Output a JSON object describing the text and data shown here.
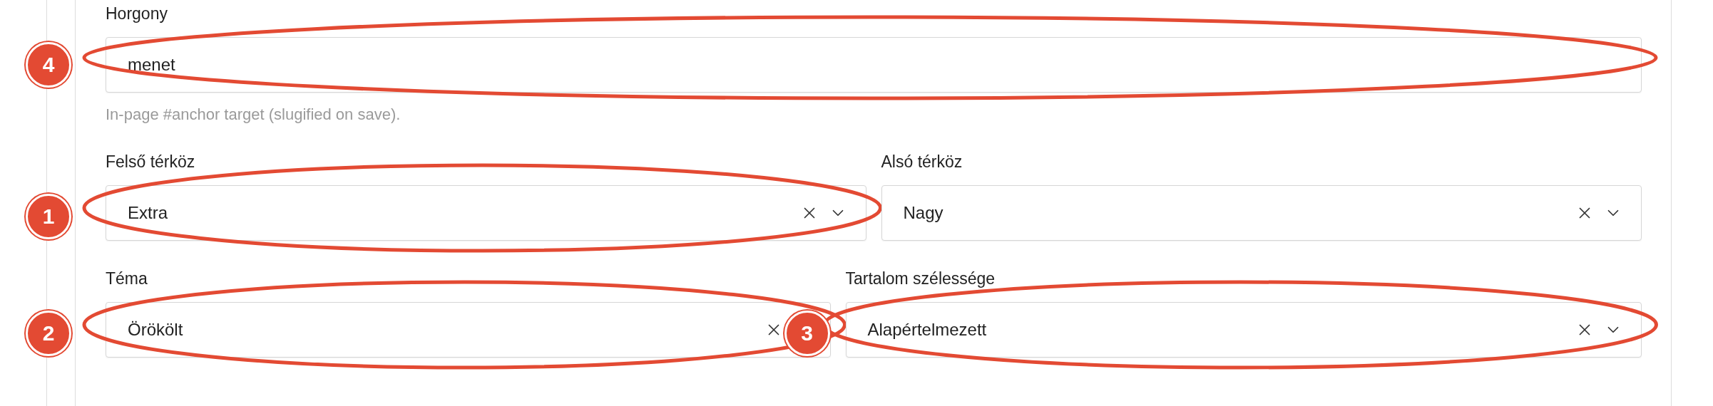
{
  "rows": [
    {
      "columns": [
        {
          "kind": "text",
          "label": "Horgony",
          "value": "menet",
          "help": "In-page #anchor target (slugified on save).",
          "annotation": "4"
        }
      ]
    },
    {
      "columns": [
        {
          "kind": "select",
          "label": "Felső térköz",
          "value": "Extra",
          "clearable": true,
          "chevron": true,
          "annotation": "1"
        },
        {
          "kind": "select",
          "label": "Alsó térköz",
          "value": "Nagy",
          "clearable": true,
          "chevron": true
        }
      ]
    },
    {
      "columns": [
        {
          "kind": "select",
          "label": "Téma",
          "value": "Örökölt",
          "clearable": true,
          "chevron": false,
          "annotation": "2"
        },
        {
          "kind": "select",
          "label": "Tartalom szélessége",
          "value": "Alapértelmezett",
          "clearable": true,
          "chevron": true,
          "annotation": "3"
        }
      ]
    }
  ]
}
